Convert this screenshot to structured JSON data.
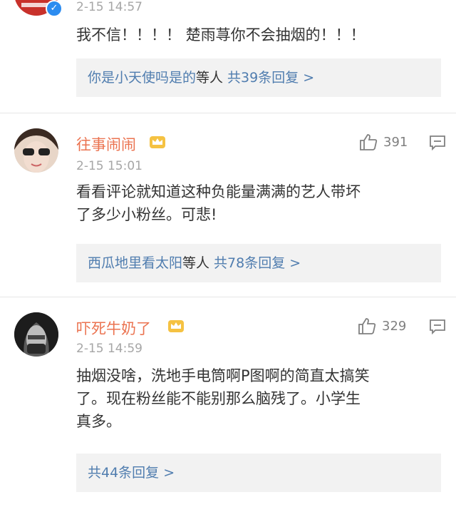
{
  "comments": [
    {
      "time": "2-15 14:57",
      "text": "我不信！！！！ 楚雨荨你不会抽烟的！！！",
      "replies": {
        "names": "你是小天使吗是的",
        "deng": "等人",
        "count": "共39条回复 >"
      }
    },
    {
      "username": "往事闹闹",
      "likes": "391",
      "time": "2-15 15:01",
      "text_lines": [
        "看看评论就知道这种负能量满满的艺人带坏",
        "了多少小粉丝。可悲!"
      ],
      "replies": {
        "names": "西瓜地里看太阳",
        "deng": "等人",
        "count": "共78条回复 >"
      }
    },
    {
      "username": "吓死牛奶了",
      "likes": "329",
      "time": "2-15 14:59",
      "text_lines": [
        "抽烟没啥，洗地手电筒啊P图啊的简直太搞笑",
        "了。现在粉丝能不能别那么脑残了。小学生",
        "真多。"
      ],
      "replies": {
        "count": "共44条回复 >"
      }
    }
  ],
  "colors": {
    "username": "#eb7350",
    "link": "#507daf",
    "meta": "#a6a6a6",
    "reply_bg": "#f2f2f2"
  },
  "icons": [
    "verified-badge-icon",
    "crown-icon",
    "thumb-up-icon",
    "comment-icon"
  ]
}
